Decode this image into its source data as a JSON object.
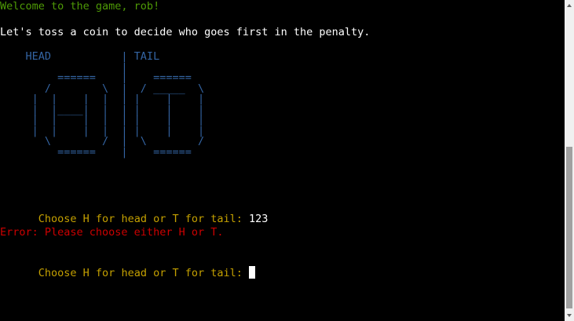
{
  "terminal": {
    "welcome": "Welcome to the game, rob!",
    "intro": "Let's toss a coin to decide who goes first in the penalty.",
    "coin_art": "    HEAD           | TAIL\n                   |\n         ======    |    ======\n       /        \\  |  / _____  \\\n     |  |    |  |  | |    |    |\n     |  |____|  |  | |    |    |\n     |  |    |  |  | |    |    |\n     |  |    |  |  | |    |    |\n       \\        /  |  \\        /\n         ======    |    ======",
    "prompt_1": "Choose H for head or T for tail: ",
    "input_1": "123",
    "error": "Error: Please choose either H or T.",
    "prompt_2": "Choose H for head or T for tail: "
  },
  "colors": {
    "background": "#000000",
    "welcome": "#4e9a06",
    "text": "#ffffff",
    "art": "#3465a4",
    "prompt": "#c4a000",
    "error": "#cc0000"
  }
}
